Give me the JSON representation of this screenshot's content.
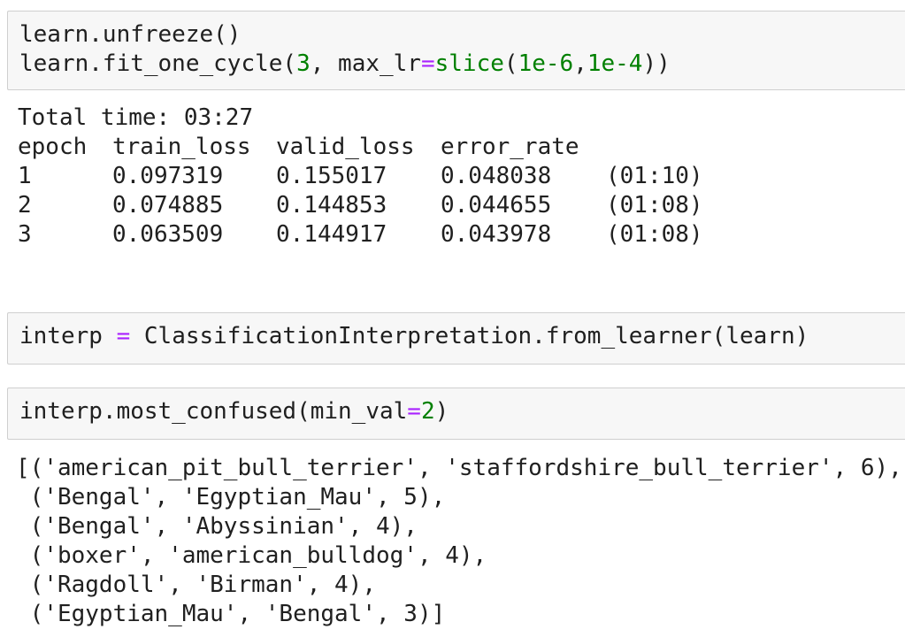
{
  "cells": {
    "cell1": {
      "line1": "learn.unfreeze()",
      "line2_pre": "learn.fit_one_cycle(",
      "line2_num": "3",
      "line2_mid": ", max_lr",
      "line2_eq": "=",
      "line2_builtin": "slice",
      "line2_paren": "(",
      "line2_arg1": "1e-6",
      "line2_comma": ",",
      "line2_arg2": "1e-4",
      "line2_end": "))"
    },
    "output1": {
      "total_time": "Total time: 03:27",
      "headers": [
        "epoch",
        "train_loss",
        "valid_loss",
        "error_rate",
        ""
      ],
      "rows": [
        [
          "1",
          "0.097319",
          "0.155017",
          "0.048038",
          "(01:10)"
        ],
        [
          "2",
          "0.074885",
          "0.144853",
          "0.044655",
          "(01:08)"
        ],
        [
          "3",
          "0.063509",
          "0.144917",
          "0.043978",
          "(01:08)"
        ]
      ]
    },
    "cell2": {
      "lhs": "interp ",
      "eq": "=",
      "rhs": " ClassificationInterpretation.from_learner(learn)"
    },
    "cell3": {
      "pre": "interp.most_confused(min_val",
      "eq": "=",
      "num": "2",
      "end": ")"
    },
    "output3": {
      "lines": [
        "[('american_pit_bull_terrier', 'staffordshire_bull_terrier', 6),",
        " ('Bengal', 'Egyptian_Mau', 5),",
        " ('Bengal', 'Abyssinian', 4),",
        " ('boxer', 'american_bulldog', 4),",
        " ('Ragdoll', 'Birman', 4),",
        " ('Egyptian_Mau', 'Bengal', 3)]"
      ]
    }
  },
  "colors": {
    "cell_bg": "#f7f7f7",
    "cell_border": "#cfcfcf",
    "number_green": "#008000",
    "operator_purple": "#aa22ff"
  }
}
